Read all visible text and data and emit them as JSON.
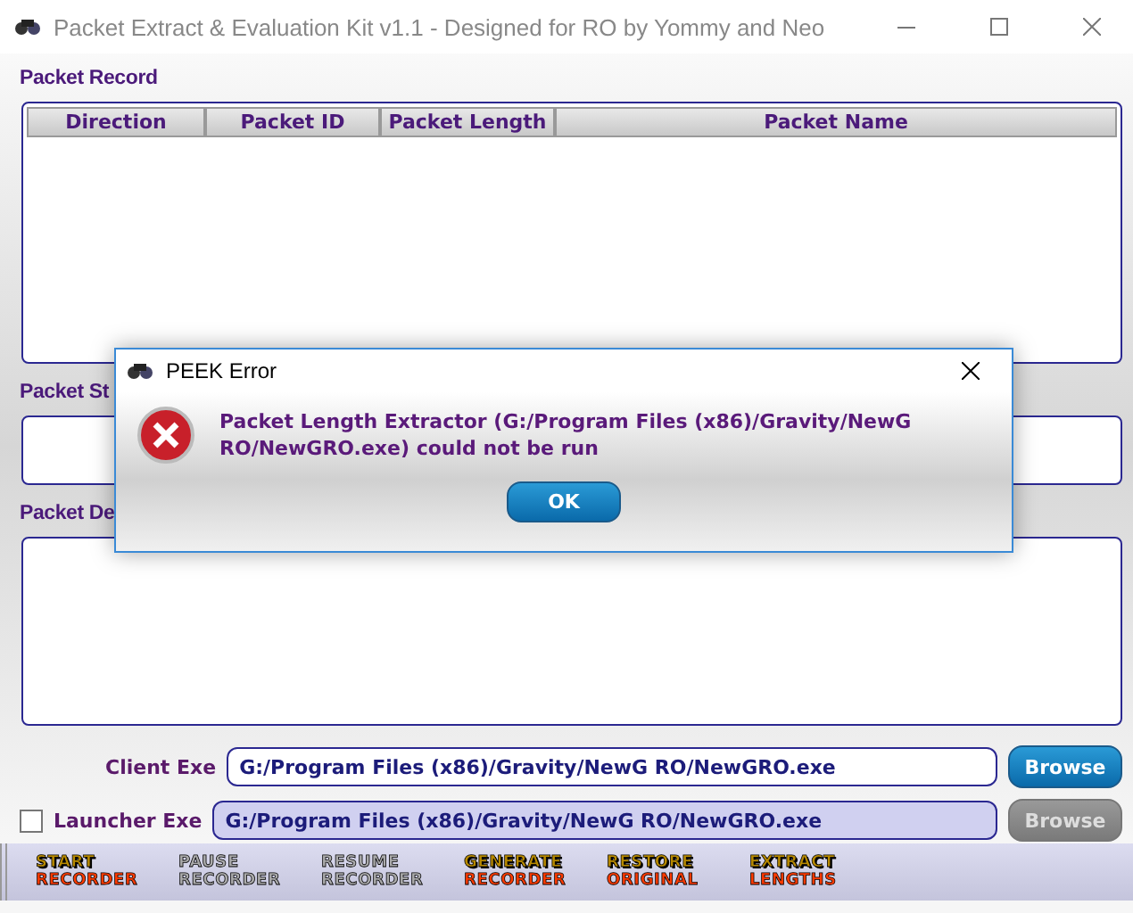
{
  "window": {
    "title": "Packet Extract & Evaluation Kit v1.1 - Designed for RO by Yommy and Neo"
  },
  "packet_record": {
    "label": "Packet Record",
    "columns": [
      "Direction",
      "Packet ID",
      "Packet Length",
      "Packet Name"
    ]
  },
  "packet_structure": {
    "label": "Packet St"
  },
  "packet_description": {
    "label": "Packet De"
  },
  "client_exe": {
    "label": "Client Exe",
    "value": "G:/Program Files (x86)/Gravity/NewG RO/NewGRO.exe",
    "browse": {
      "label": "Browse",
      "disabled": false
    }
  },
  "launcher_exe": {
    "label": "Launcher Exe",
    "checked": false,
    "value": "G:/Program Files (x86)/Gravity/NewG RO/NewGRO.exe",
    "browse": {
      "label": "Browse",
      "disabled": true
    }
  },
  "toolbar": [
    {
      "top": "START",
      "bottom": "RECORDER",
      "disabled": false
    },
    {
      "top": "PAUSE",
      "bottom": "RECORDER",
      "disabled": true
    },
    {
      "top": "RESUME",
      "bottom": "RECORDER",
      "disabled": true
    },
    {
      "top": "GENERATE",
      "bottom": "RECORDER",
      "disabled": false
    },
    {
      "top": "RESTORE",
      "bottom": "ORIGINAL",
      "disabled": false
    },
    {
      "top": "EXTRACT",
      "bottom": "LENGTHS",
      "disabled": false
    }
  ],
  "dialog": {
    "title": "PEEK Error",
    "message": "Packet Length Extractor (G:/Program Files (x86)/Gravity/NewG RO/NewGRO.exe) could not be run",
    "buttons": [
      "OK"
    ]
  }
}
